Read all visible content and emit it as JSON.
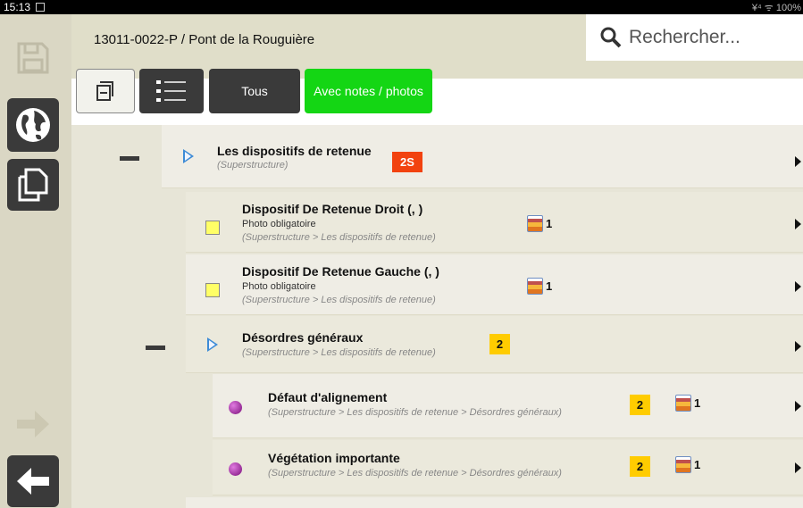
{
  "status": {
    "time": "15:13",
    "right": "¥⁴ ᯤ 100%"
  },
  "header": {
    "title": "13011-0022-P / Pont de la Rouguière",
    "search_placeholder": "Rechercher..."
  },
  "toolbar": {
    "tous": "Tous",
    "notes": "Avec notes / photos"
  },
  "rows": [
    {
      "title": "Les dispositifs de retenue",
      "path": "(Superstructure)",
      "badge": "2S"
    },
    {
      "title": "Dispositif De Retenue Droit (, )",
      "sub": "Photo obligatoire",
      "path": "(Superstructure > Les dispositifs de retenue)",
      "photos": "1"
    },
    {
      "title": "Dispositif De Retenue Gauche (, )",
      "sub": "Photo obligatoire",
      "path": "(Superstructure > Les dispositifs de retenue)",
      "photos": "1"
    },
    {
      "title": "Désordres généraux",
      "path": "(Superstructure > Les dispositifs de retenue)",
      "badge": "2"
    },
    {
      "title": "Défaut d'alignement",
      "path": "(Superstructure > Les dispositifs de retenue > Désordres généraux)",
      "badge": "2",
      "photos": "1"
    },
    {
      "title": "Végétation importante",
      "path": "(Superstructure > Les dispositifs de retenue > Désordres généraux)",
      "badge": "2",
      "photos": "1"
    }
  ],
  "colors": {
    "accent_green": "#14d614",
    "badge_red": "#f2420f",
    "badge_yellow": "#ffcc00",
    "dark_button": "#3a3a3a"
  },
  "icons": [
    "save-icon",
    "globe-icon",
    "copy-icon",
    "arrow-right-icon",
    "arrow-left-icon",
    "search-icon",
    "collapse-icon",
    "list-icon",
    "expand-arrow-icon",
    "chevron-right-icon"
  ]
}
